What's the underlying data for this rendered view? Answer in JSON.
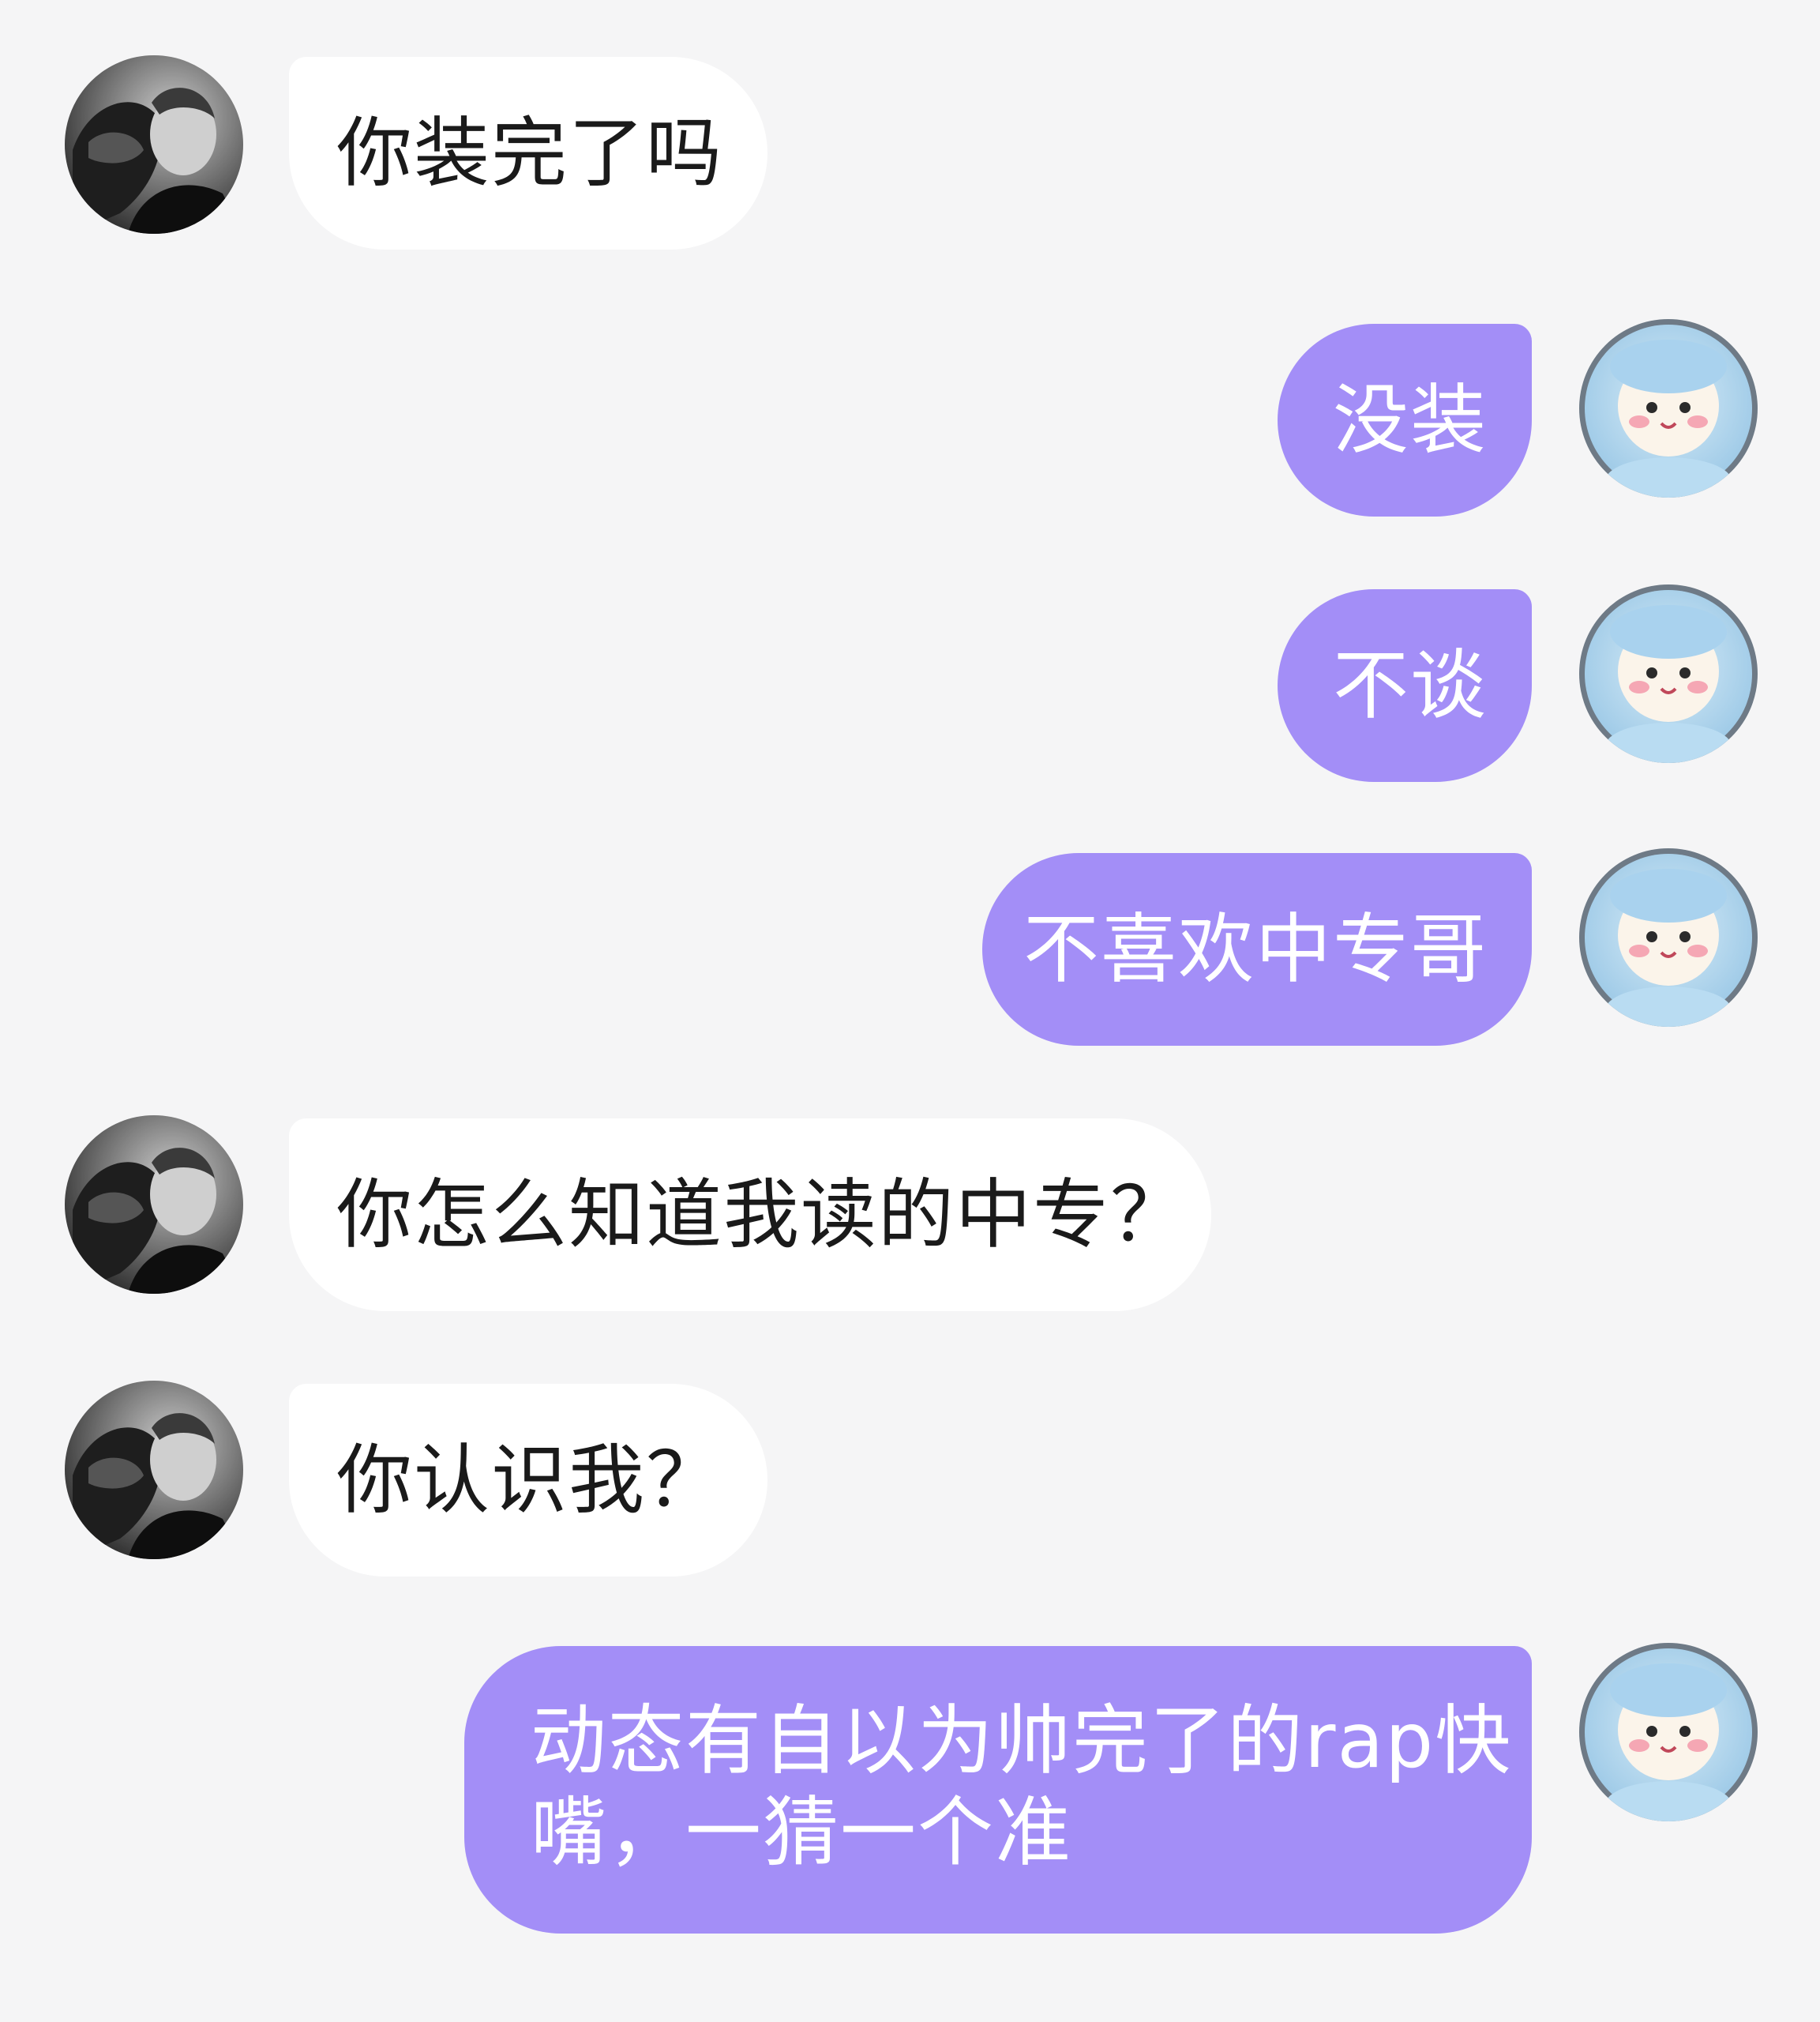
{
  "colors": {
    "background": "#f5f5f6",
    "incoming_bubble": "#ffffff",
    "outgoing_bubble": "#a38ef7",
    "incoming_text": "#1a1a1a",
    "outgoing_text": "#ffffff"
  },
  "messages": [
    {
      "sender": "other",
      "avatar": "profile-photo-icon",
      "lines": [
        "你装完了吗"
      ]
    },
    {
      "sender": "me",
      "avatar": "plush-toy-icon",
      "lines": [
        "没装"
      ]
    },
    {
      "sender": "me",
      "avatar": "plush-toy-icon",
      "lines": [
        "不谈"
      ]
    },
    {
      "sender": "me",
      "avatar": "plush-toy-icon",
      "lines": [
        "不喜欢中专哥"
      ]
    },
    {
      "sender": "other",
      "avatar": "profile-photo-icon",
      "lines": [
        "你怎么知道我读的中专？"
      ]
    },
    {
      "sender": "other",
      "avatar": "profile-photo-icon",
      "lines": [
        "你认识我？"
      ]
    },
    {
      "sender": "me",
      "avatar": "plush-toy-icon",
      "lines": [
        "动态有自以为帅完了的rap快",
        "嘴，一猜一个准"
      ]
    }
  ]
}
